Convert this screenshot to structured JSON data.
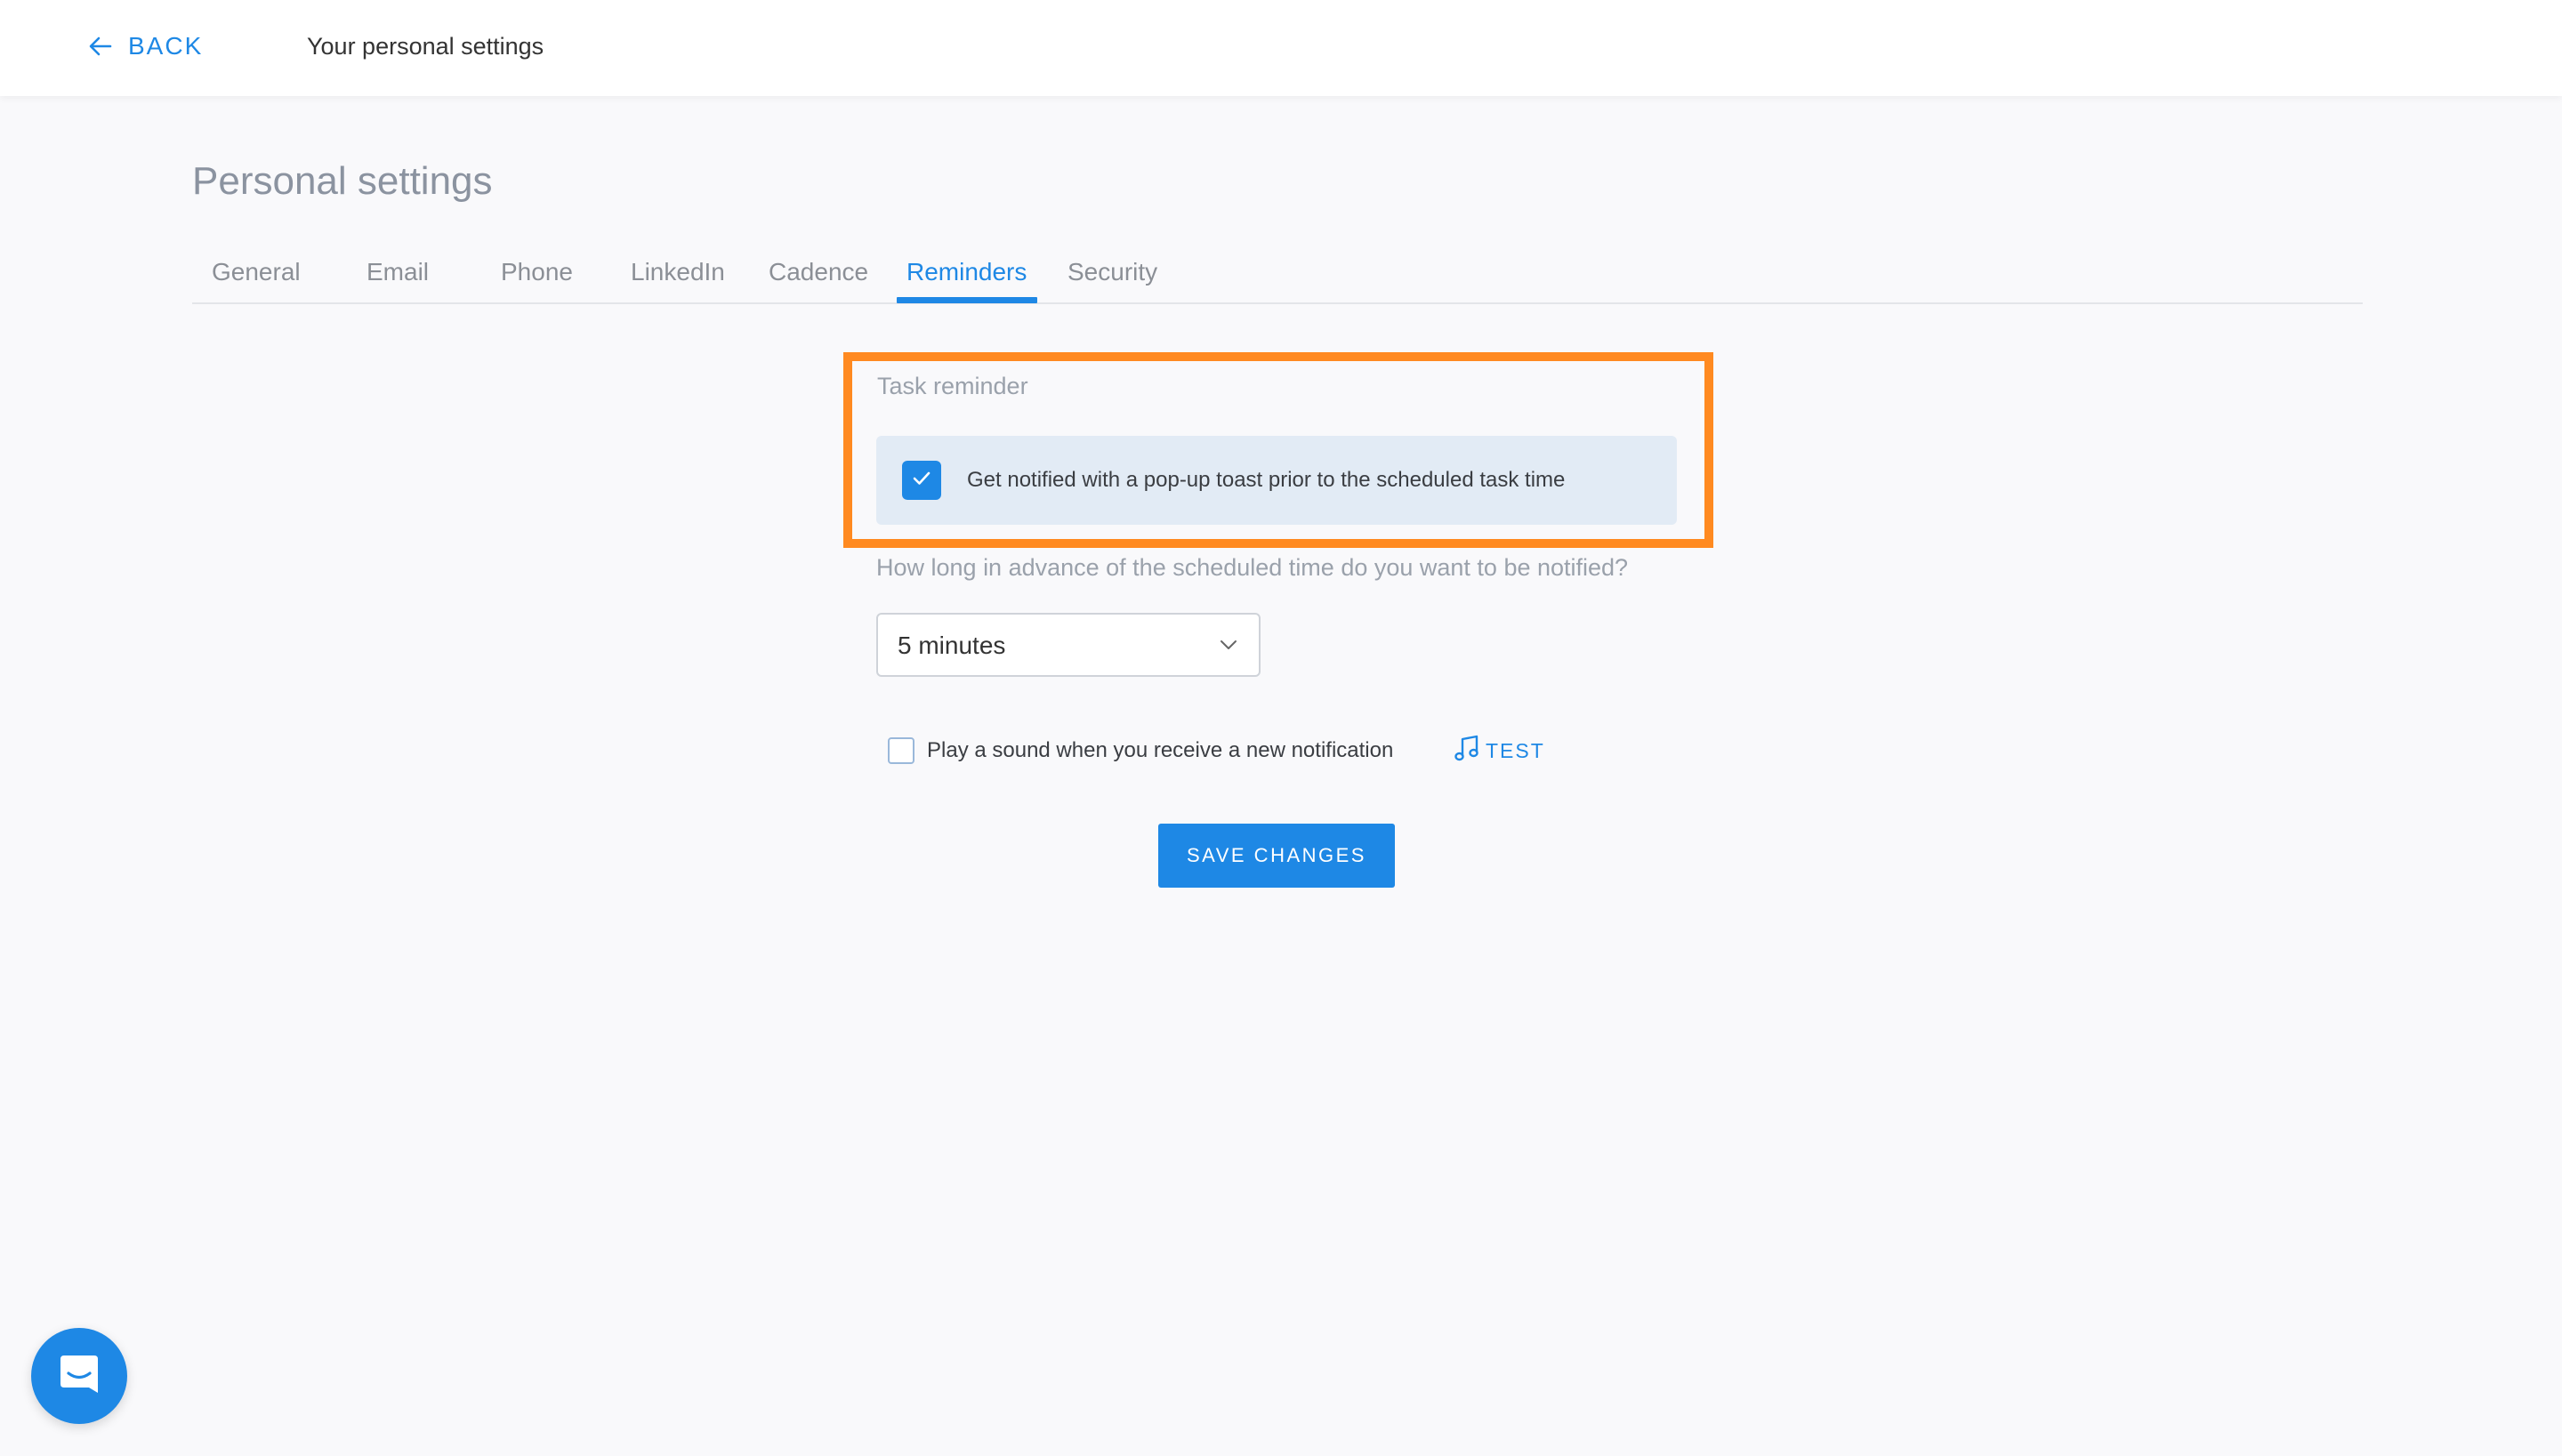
{
  "header": {
    "back_label": "BACK",
    "title": "Your personal settings"
  },
  "page": {
    "title": "Personal settings"
  },
  "tabs": [
    {
      "label": "General",
      "active": false
    },
    {
      "label": "Email",
      "active": false
    },
    {
      "label": "Phone",
      "active": false
    },
    {
      "label": "LinkedIn",
      "active": false
    },
    {
      "label": "Cadence",
      "active": false
    },
    {
      "label": "Reminders",
      "active": true
    },
    {
      "label": "Security",
      "active": false
    }
  ],
  "task_reminder": {
    "section_label": "Task reminder",
    "toast_option_label": "Get notified with a pop-up toast prior to the scheduled task time",
    "toast_option_checked": true
  },
  "advance": {
    "question": "How long in advance of the scheduled time do you want to be notified?",
    "selected_value": "5 minutes"
  },
  "sound": {
    "label": "Play a sound when you receive a new notification",
    "checked": false,
    "test_label": "TEST"
  },
  "actions": {
    "save_label": "SAVE CHANGES"
  },
  "colors": {
    "accent": "#1e88e5",
    "highlight": "#ff8a20",
    "background": "#f9f9fb"
  },
  "icons": {
    "back": "arrow-left-icon",
    "check": "checkmark-icon",
    "dropdown": "chevron-down-icon",
    "music": "music-note-icon",
    "chat": "chat-bubble-icon"
  }
}
